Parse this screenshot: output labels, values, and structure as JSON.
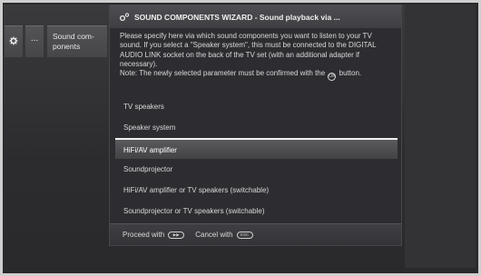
{
  "left_menu": {
    "gear_icon": "gear-icon",
    "dots_label": "...",
    "sound_label": "Sound com-\nponents"
  },
  "wizard": {
    "title": "SOUND COMPONENTS WIZARD - Sound playback via ...",
    "title_icon": "settings-icon",
    "description_1": "Please specify here via which sound components you want to listen to your TV sound. If you select a \"Speaker system\", this must be connected to the DIGITAL AUDIO LINK socket on the back of the TV set (with an additional adapter if necessary).",
    "note_before": "Note: The newly selected parameter must be confirmed with the",
    "note_after": "button.",
    "ok_key_label": "OK",
    "options": [
      "TV speakers",
      "Speaker system",
      "HiFi/AV amplifier",
      "Soundprojector",
      "HiFi/AV amplifier or TV speakers (switchable)",
      "Soundprojector or TV speakers (switchable)"
    ],
    "selected_index": 2,
    "footer": {
      "proceed_label": "Proceed with",
      "proceed_key": "▶▶",
      "cancel_label": "Cancel with",
      "cancel_key": "ESC"
    }
  }
}
